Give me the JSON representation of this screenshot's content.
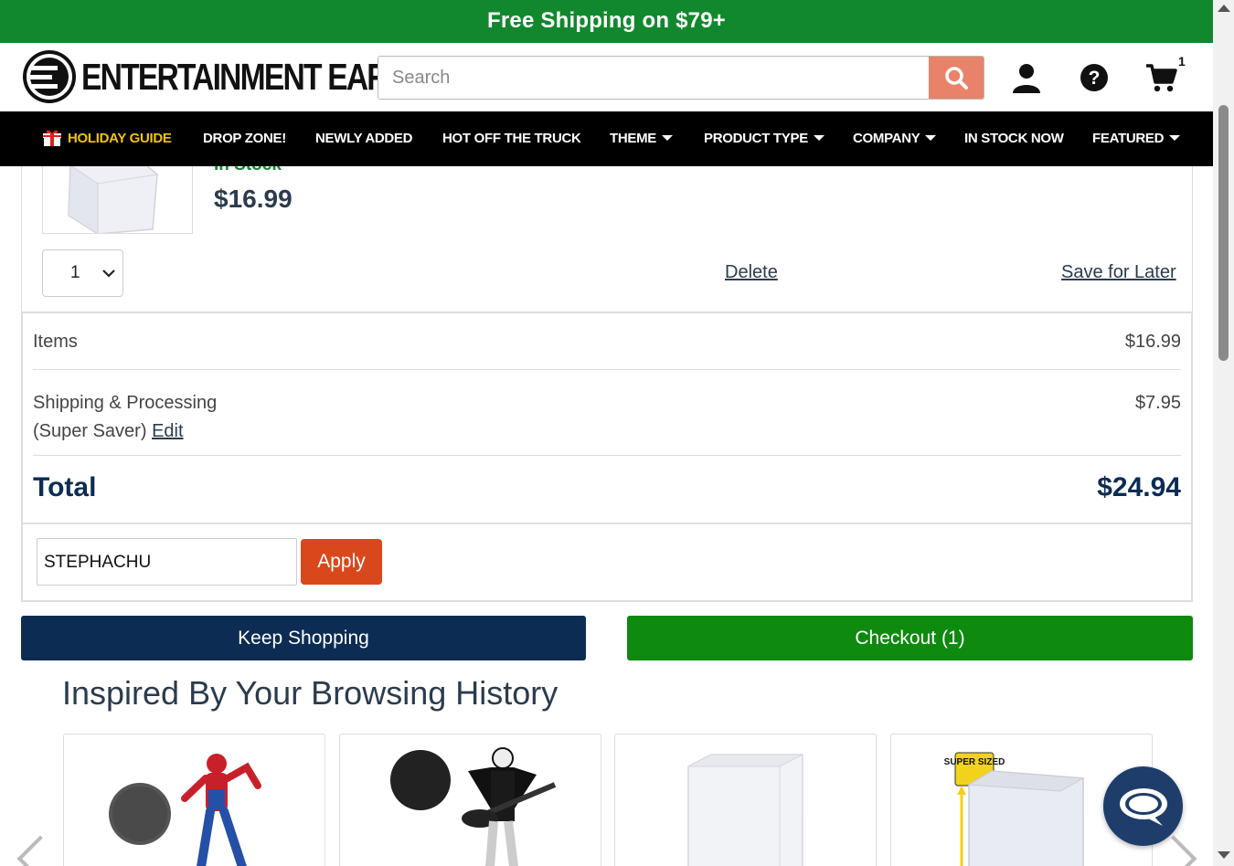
{
  "banner": {
    "text": "Free Shipping on $79+"
  },
  "header": {
    "logo_text": "ENTERTAINMENT EARTH",
    "search_placeholder": "Search",
    "cart_count": "1"
  },
  "nav": {
    "items": [
      {
        "label": "HOLIDAY GUIDE"
      },
      {
        "label": "DROP ZONE!"
      },
      {
        "label": "NEWLY ADDED"
      },
      {
        "label": "HOT OFF THE TRUCK"
      },
      {
        "label": "THEME"
      },
      {
        "label": "PRODUCT TYPE"
      },
      {
        "label": "COMPANY"
      },
      {
        "label": "IN STOCK NOW"
      },
      {
        "label": "FEATURED"
      }
    ]
  },
  "cart_item": {
    "stock_status": "In Stock",
    "price": "$16.99",
    "quantity": "1",
    "delete_label": "Delete",
    "save_label": "Save for Later"
  },
  "summary": {
    "items_label": "Items",
    "items_value": "$16.99",
    "shipping_label": "Shipping & Processing",
    "shipping_method": "(Super Saver)",
    "edit_label": "Edit",
    "shipping_value": "$7.95",
    "total_label": "Total",
    "total_value": "$24.94"
  },
  "promo": {
    "code_value": "STEPHACHU",
    "apply_label": "Apply"
  },
  "actions": {
    "keep_shopping": "Keep Shopping",
    "checkout": "Checkout (1)"
  },
  "recommendations": {
    "heading": "Inspired By Your Browsing History",
    "super_sized_badge": "SUPER SIZED"
  },
  "colors": {
    "banner_green": "#12882e",
    "navy": "#0d2c54",
    "checkout_green": "#0e8a0e",
    "apply_orange": "#d9481c",
    "search_orange": "#e8836a"
  }
}
